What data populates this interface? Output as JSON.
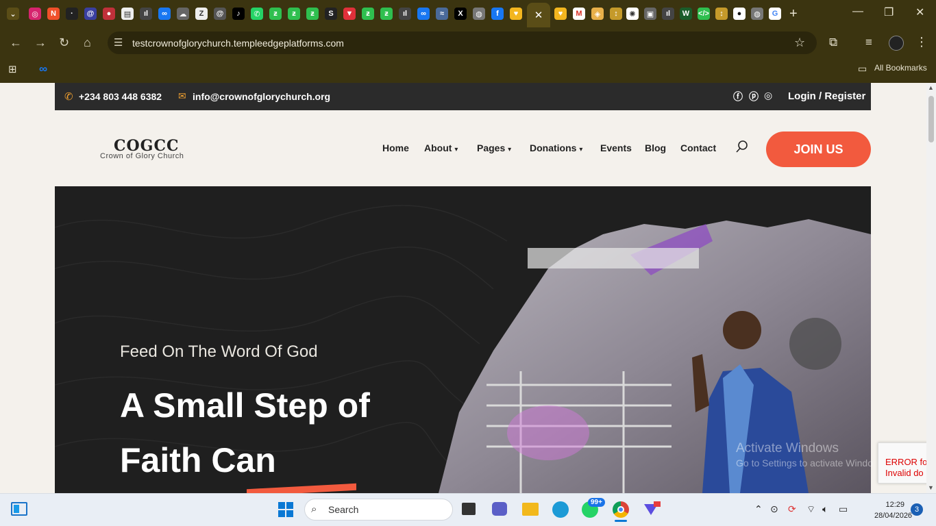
{
  "browser": {
    "url": "testcrownofglorychurch.templeedgeplatforms.com",
    "all_bookmarks": "All Bookmarks",
    "close_tab": "✕",
    "new_tab": "+"
  },
  "site": {
    "phone": "+234 803 448 6382",
    "email": "info@crownofglorychurch.org",
    "login": "Login / Register",
    "logo_title": "COGCC",
    "logo_subtitle": "Crown of Glory Church",
    "nav": [
      "Home",
      "About",
      "Pages",
      "Donations",
      "Events",
      "Blog",
      "Contact"
    ],
    "join": "JOIN US",
    "hero_tagline": "Feed On The Word Of God",
    "hero_title": "A Small Step of Faith Can"
  },
  "overlays": {
    "activate_line1": "Activate Windows",
    "activate_line2": "Go to Settings to activate Windows.",
    "recaptcha_line1": "ERROR for",
    "recaptcha_line2": "Invalid do"
  },
  "taskbar": {
    "search": "Search",
    "time": "12:29",
    "date": "28/04/2026",
    "whatsapp_badge": "99+",
    "notification_count": "3"
  },
  "colors": {
    "accent": "#f25a3e",
    "topbar": "#2b2b2b",
    "hero_bg": "#1f1f1f",
    "chrome": "#3b3410"
  }
}
